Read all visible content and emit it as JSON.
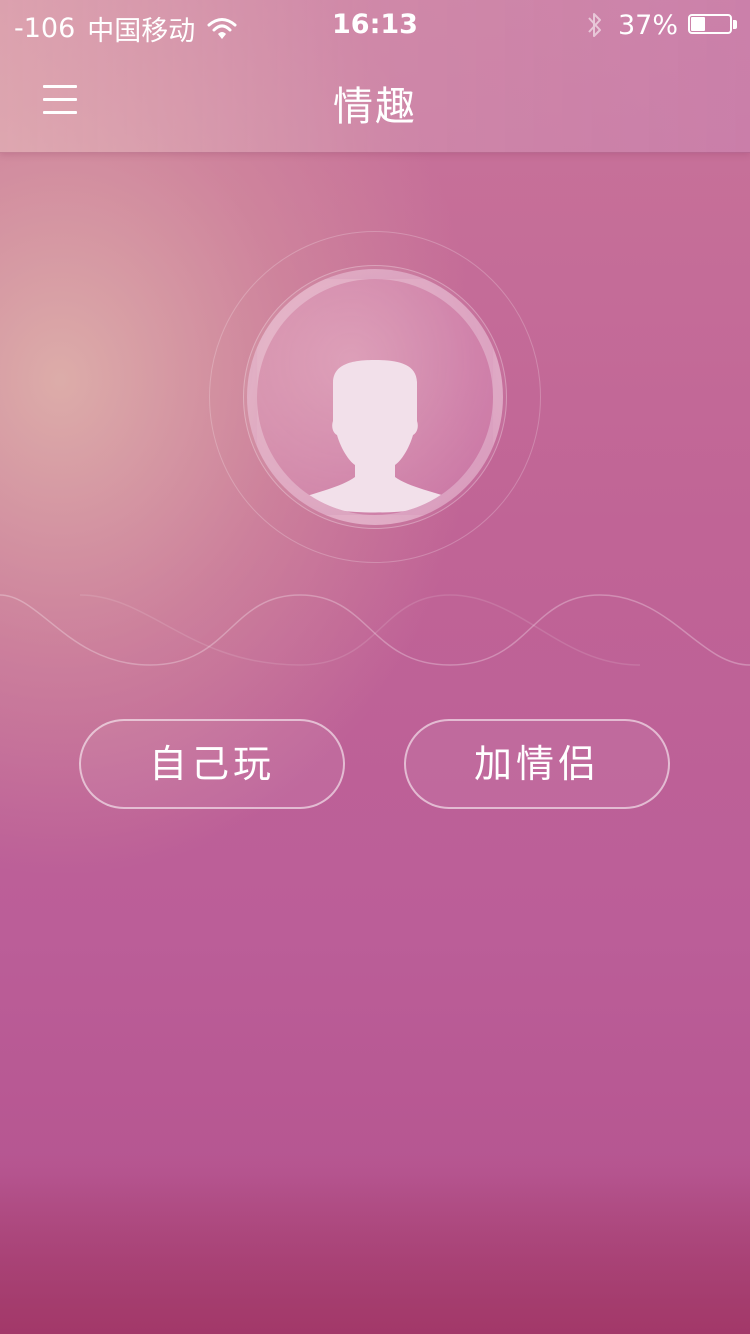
{
  "status_bar": {
    "signal": "-106",
    "carrier": "中国移动",
    "time": "16:13",
    "battery_percent_text": "37%",
    "battery_level": 0.37
  },
  "nav": {
    "title": "情趣",
    "menu_icon": "hamburger-menu-icon"
  },
  "avatar": {
    "icon": "default-user-avatar-icon"
  },
  "actions": {
    "solo_label": "自己玩",
    "couple_label": "加情侣"
  },
  "colors": {
    "background_top": "#c9759a",
    "background_bottom": "#a5406f",
    "glow": "#deb0aa",
    "text": "#ffffff"
  }
}
